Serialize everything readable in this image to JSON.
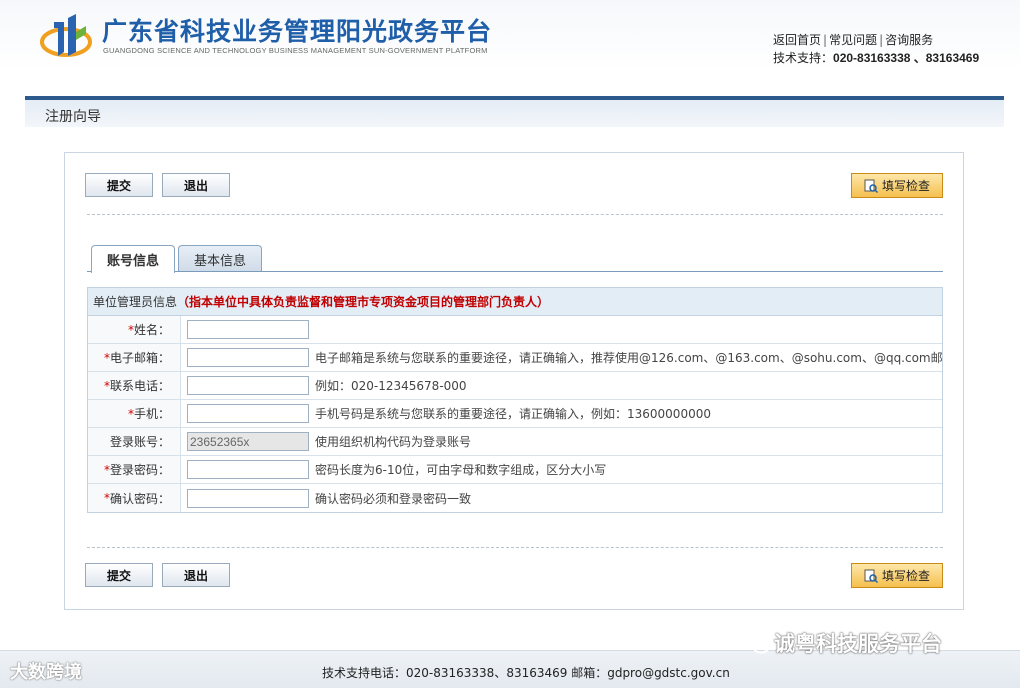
{
  "header": {
    "title": "广东省科技业务管理阳光政务平台",
    "subtitle": "GUANGDONG SCIENCE AND TECHNOLOGY BUSINESS MANAGEMENT SUN-GOVERNMENT PLATFORM",
    "links": [
      "返回首页",
      "常见问题",
      "咨询服务"
    ],
    "support_label": "技术支持：",
    "support_numbers": "020-83163338 、83163469"
  },
  "banner": {
    "title": "注册向导"
  },
  "toolbar": {
    "submit_label": "提交",
    "exit_label": "退出",
    "check_label": "填写检查"
  },
  "tabs": [
    {
      "label": "账号信息",
      "active": true
    },
    {
      "label": "基本信息",
      "active": false
    }
  ],
  "form": {
    "header_label": "单位管理员信息",
    "header_note": "（指本单位中具体负责监督和管理市专项资金项目的管理部门负责人）",
    "rows": [
      {
        "required": true,
        "label": "姓名：",
        "value": "",
        "hint": ""
      },
      {
        "required": true,
        "label": "电子邮箱：",
        "value": "",
        "hint": "电子邮箱是系统与您联系的重要途径，请正确输入，推荐使用@126.com、@163.com、@sohu.com、@qq.com邮箱"
      },
      {
        "required": true,
        "label": "联系电话：",
        "value": "",
        "hint": "例如：020-12345678-000"
      },
      {
        "required": true,
        "label": "手机：",
        "value": "",
        "hint": "手机号码是系统与您联系的重要途径，请正确输入，例如：13600000000"
      },
      {
        "required": false,
        "label": "登录账号：",
        "value": "23652365x",
        "hint": "使用组织机构代码为登录账号"
      },
      {
        "required": true,
        "label": "登录密码：",
        "value": "",
        "hint": "密码长度为6-10位，可由字母和数字组成，区分大小写"
      },
      {
        "required": true,
        "label": "确认密码：",
        "value": "",
        "hint": "确认密码必须和登录密码一致"
      }
    ],
    "required_mark": "*"
  },
  "footer": {
    "text": "技术支持电话：020-83163338、83163469 邮箱：gdpro@gdstc.gov.cn"
  },
  "watermarks": {
    "left": "大数跨境",
    "right": "诚粤科技服务平台"
  },
  "colors": {
    "brand_blue": "#1f5ea8",
    "banner_border": "#2d5a8c",
    "required_red": "#d00000",
    "check_button": "#f5c04f"
  }
}
